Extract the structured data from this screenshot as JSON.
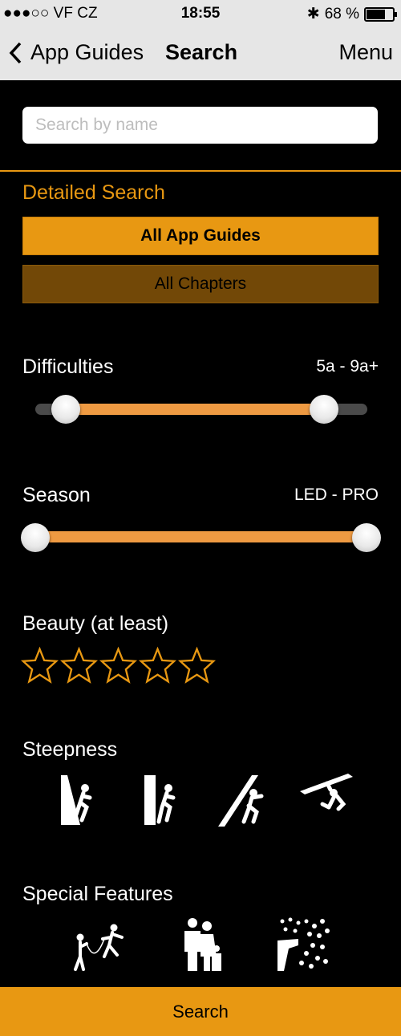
{
  "status": {
    "carrier": "●●●○○ VF CZ",
    "time": "18:55",
    "battery_text": "68 %"
  },
  "nav": {
    "back_label": "App Guides",
    "title": "Search",
    "menu_label": "Menu"
  },
  "search": {
    "placeholder": "Search by name",
    "value": ""
  },
  "detailed": {
    "title": "Detailed Search",
    "guides_button": "All App Guides",
    "chapters_button": "All Chapters"
  },
  "difficulties": {
    "label": "Difficulties",
    "value": "5a - 9a+"
  },
  "season": {
    "label": "Season",
    "value": "LED - PRO"
  },
  "beauty": {
    "label": "Beauty (at least)",
    "rating": 0,
    "max": 5
  },
  "steepness": {
    "label": "Steepness",
    "icons": [
      "slab-icon",
      "vertical-icon",
      "overhang-icon",
      "roof-icon"
    ]
  },
  "features": {
    "label": "Special Features",
    "icons": [
      "rope-climbing-icon",
      "family-icon",
      "rain-icon"
    ]
  },
  "bottom": {
    "search_label": "Search"
  },
  "colors": {
    "accent": "#e89812",
    "accent_dark": "#724807",
    "slider": "#ee9a42"
  }
}
